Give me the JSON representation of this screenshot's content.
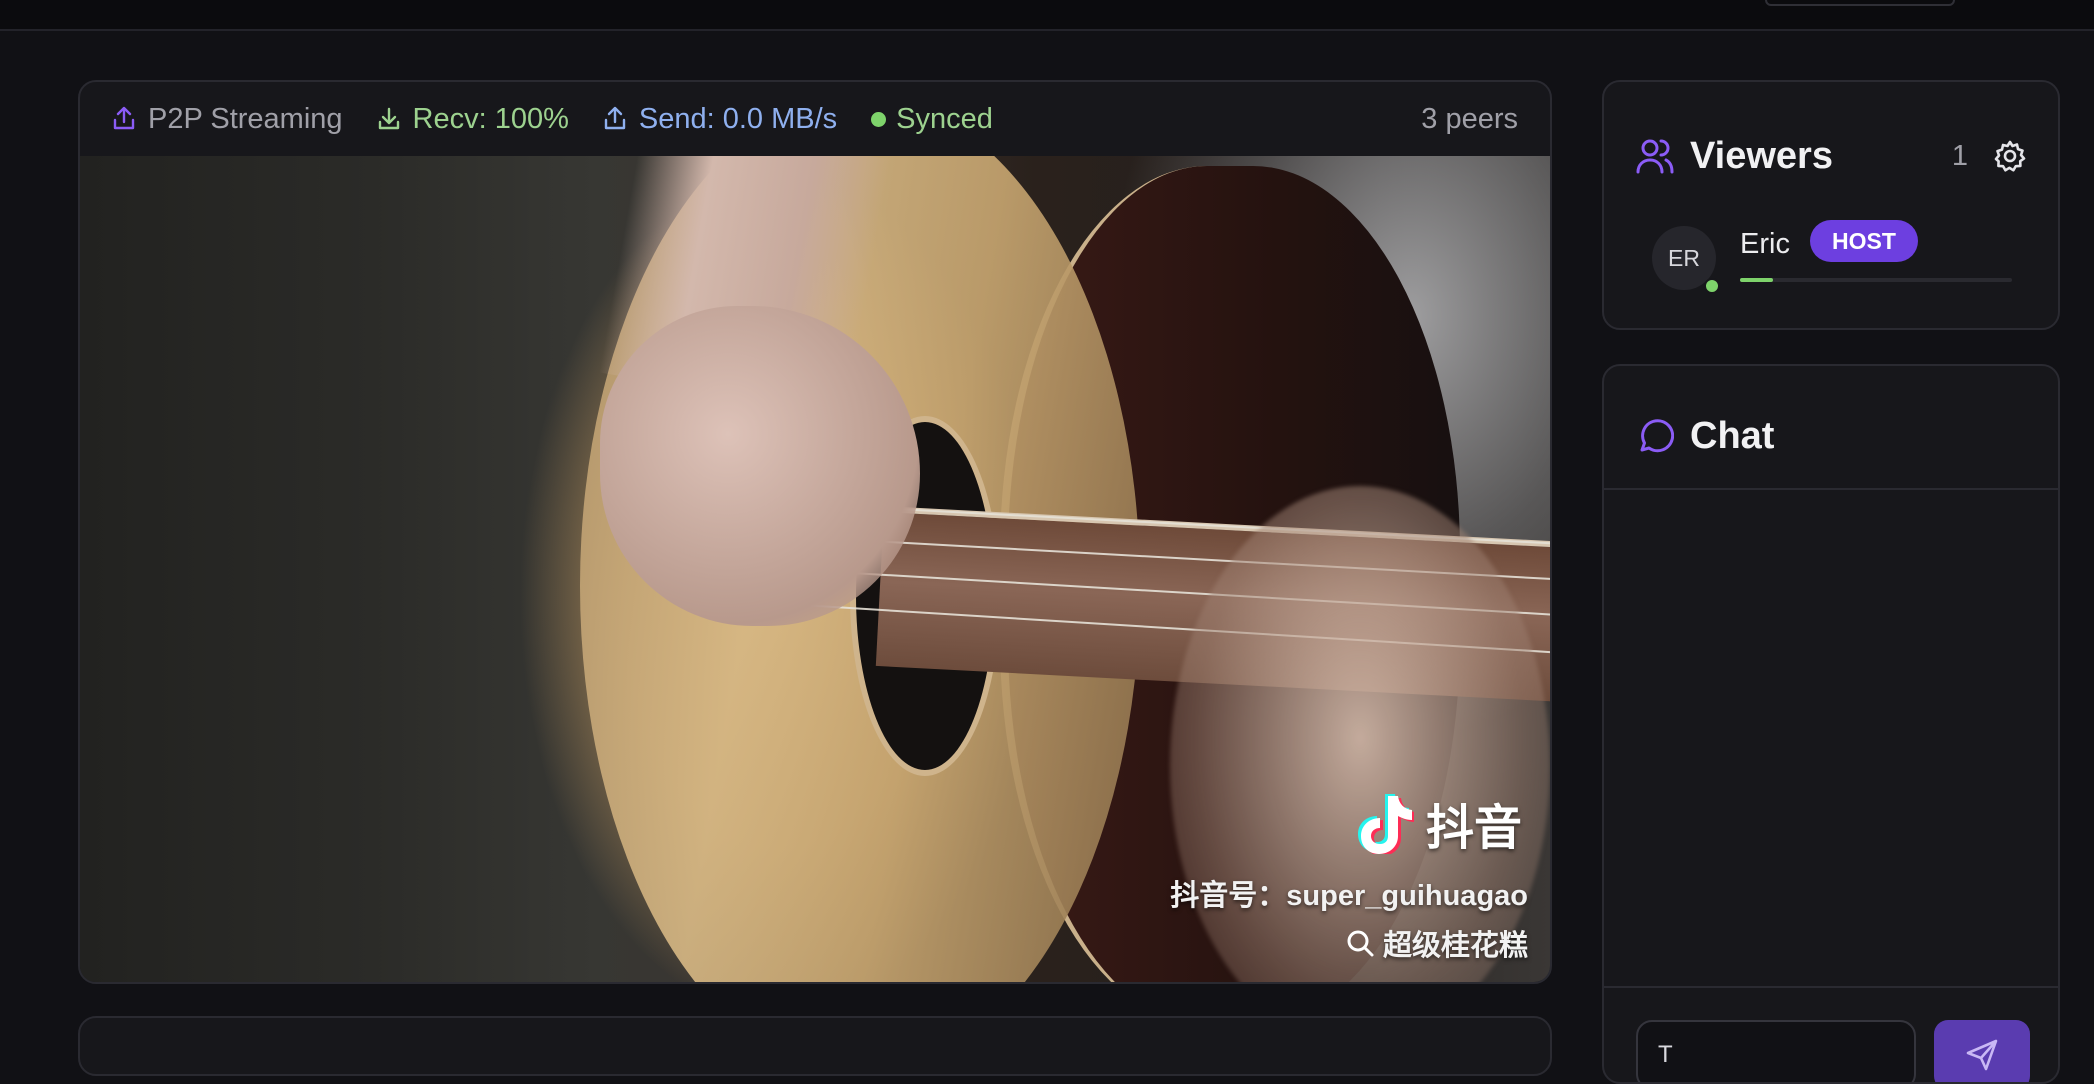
{
  "stream": {
    "mode_label": "P2P Streaming",
    "recv_label": "Recv: 100%",
    "send_label": "Send: 0.0 MB/s",
    "sync_label": "Synced",
    "peers_label": "3 peers"
  },
  "video": {
    "watermark_brand": "抖音",
    "watermark_handle": "抖音号：super_guihuagao",
    "watermark_search": "超级桂花糕"
  },
  "viewers": {
    "title": "Viewers",
    "count": "1",
    "list": [
      {
        "initials": "ER",
        "name": "Eric",
        "badge": "HOST",
        "online": true,
        "bandwidth_fraction": 0.12
      }
    ]
  },
  "chat": {
    "title": "Chat",
    "input_value": "T"
  },
  "colors": {
    "accent": "#6d3fe0",
    "online": "#7ed36b",
    "recv": "#9dd28f",
    "send": "#8fb0ef"
  }
}
